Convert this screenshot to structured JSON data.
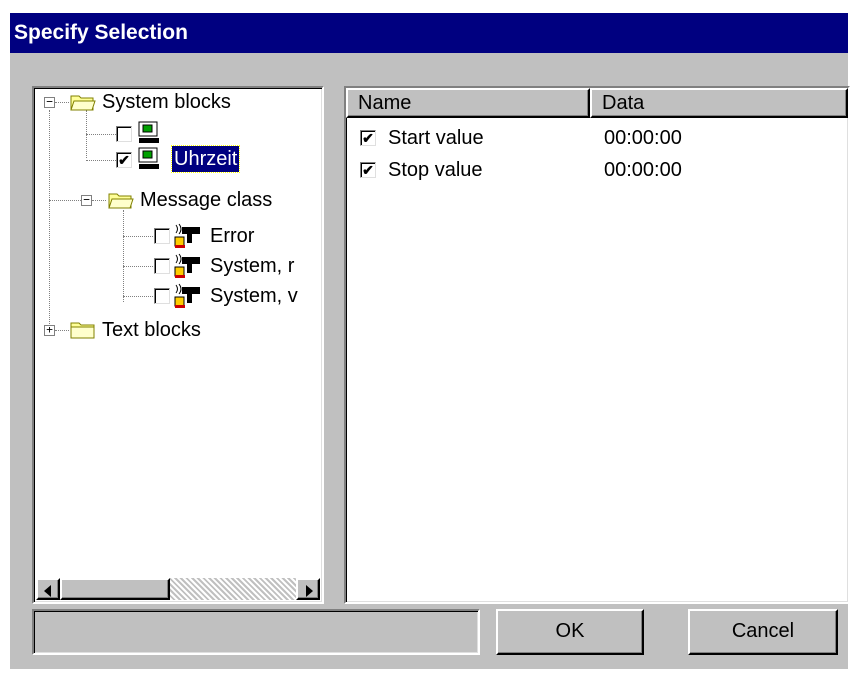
{
  "window": {
    "title": "Specify Selection"
  },
  "tree": {
    "root_system": {
      "label": "System blocks",
      "expander": "−"
    },
    "item_blank": {
      "label": "",
      "checked": false
    },
    "item_uhrzeit": {
      "label": "Uhrzeit",
      "checked": true,
      "selected": true
    },
    "message_class": {
      "label": "Message class",
      "expander": "−"
    },
    "msg_items": [
      {
        "label": "Error",
        "checked": false
      },
      {
        "label": "System, r",
        "checked": false
      },
      {
        "label": "System, v",
        "checked": false
      }
    ],
    "root_text": {
      "label": "Text blocks",
      "expander": "+"
    }
  },
  "list": {
    "columns": [
      "Name",
      "Data"
    ],
    "rows": [
      {
        "name": "Start value",
        "data": "00:00:00",
        "checked": true
      },
      {
        "name": "Stop value",
        "data": "00:00:00",
        "checked": true
      }
    ]
  },
  "status_text": "",
  "buttons": {
    "ok": "OK",
    "cancel": "Cancel"
  },
  "icons": {
    "folder": "folder-open-icon",
    "folder_closed": "folder-closed-icon",
    "block": "system-block-icon",
    "message": "message-class-icon"
  },
  "colors": {
    "titlebar": "#000080",
    "face": "#c0c0c0",
    "selection": "#000080"
  }
}
